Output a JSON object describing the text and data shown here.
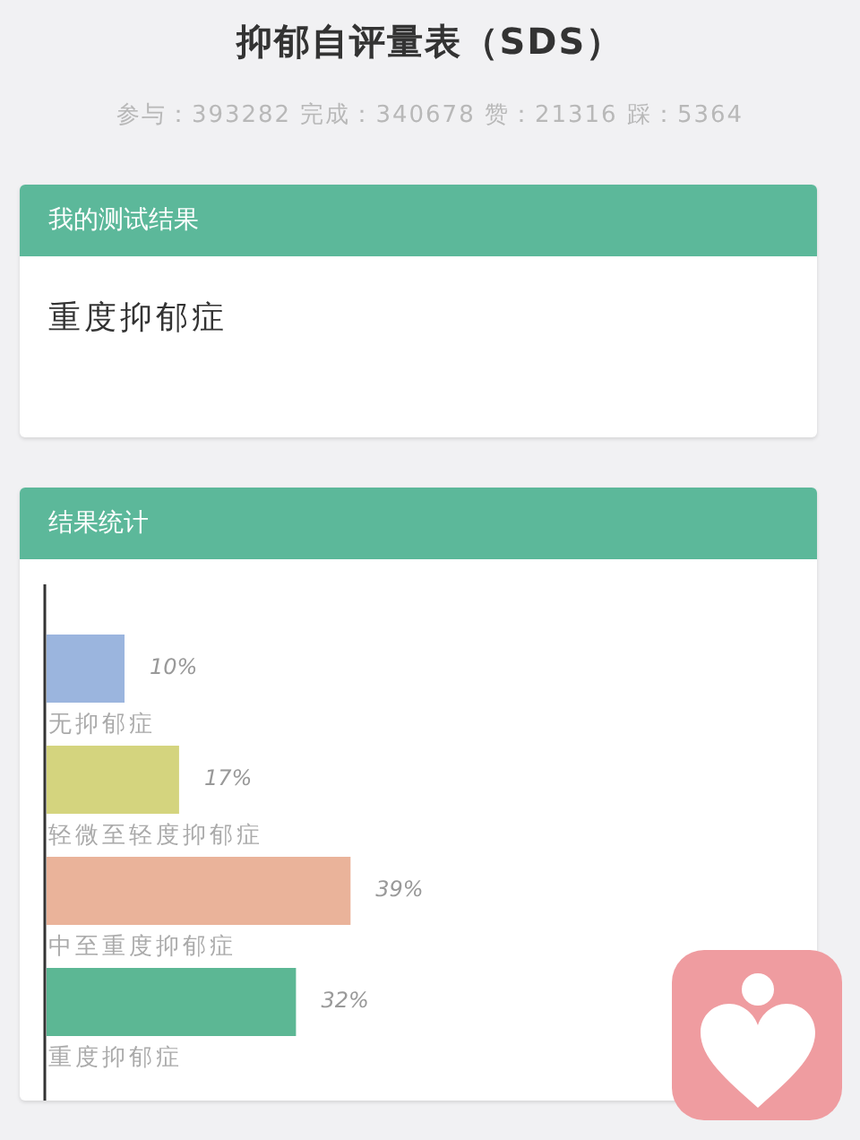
{
  "title": "抑郁自评量表（SDS）",
  "stats": "参与：393282 完成：340678 赞：21316 踩：5364",
  "result_card": {
    "header": "我的测试结果",
    "result": "重度抑郁症"
  },
  "stats_card": {
    "header": "结果统计",
    "bar_names": [
      "无抑郁症",
      "轻微至轻度抑郁症",
      "中至重度抑郁症",
      "重度抑郁症"
    ],
    "chart_data": {
      "type": "bar",
      "orientation": "horizontal",
      "values": [
        10,
        17,
        39,
        32
      ],
      "value_labels": [
        "10%",
        "17%",
        "39%",
        "32%"
      ],
      "colors": [
        "#9bb5de",
        "#d4d47e",
        "#eab39a",
        "#5cb794"
      ]
    }
  }
}
